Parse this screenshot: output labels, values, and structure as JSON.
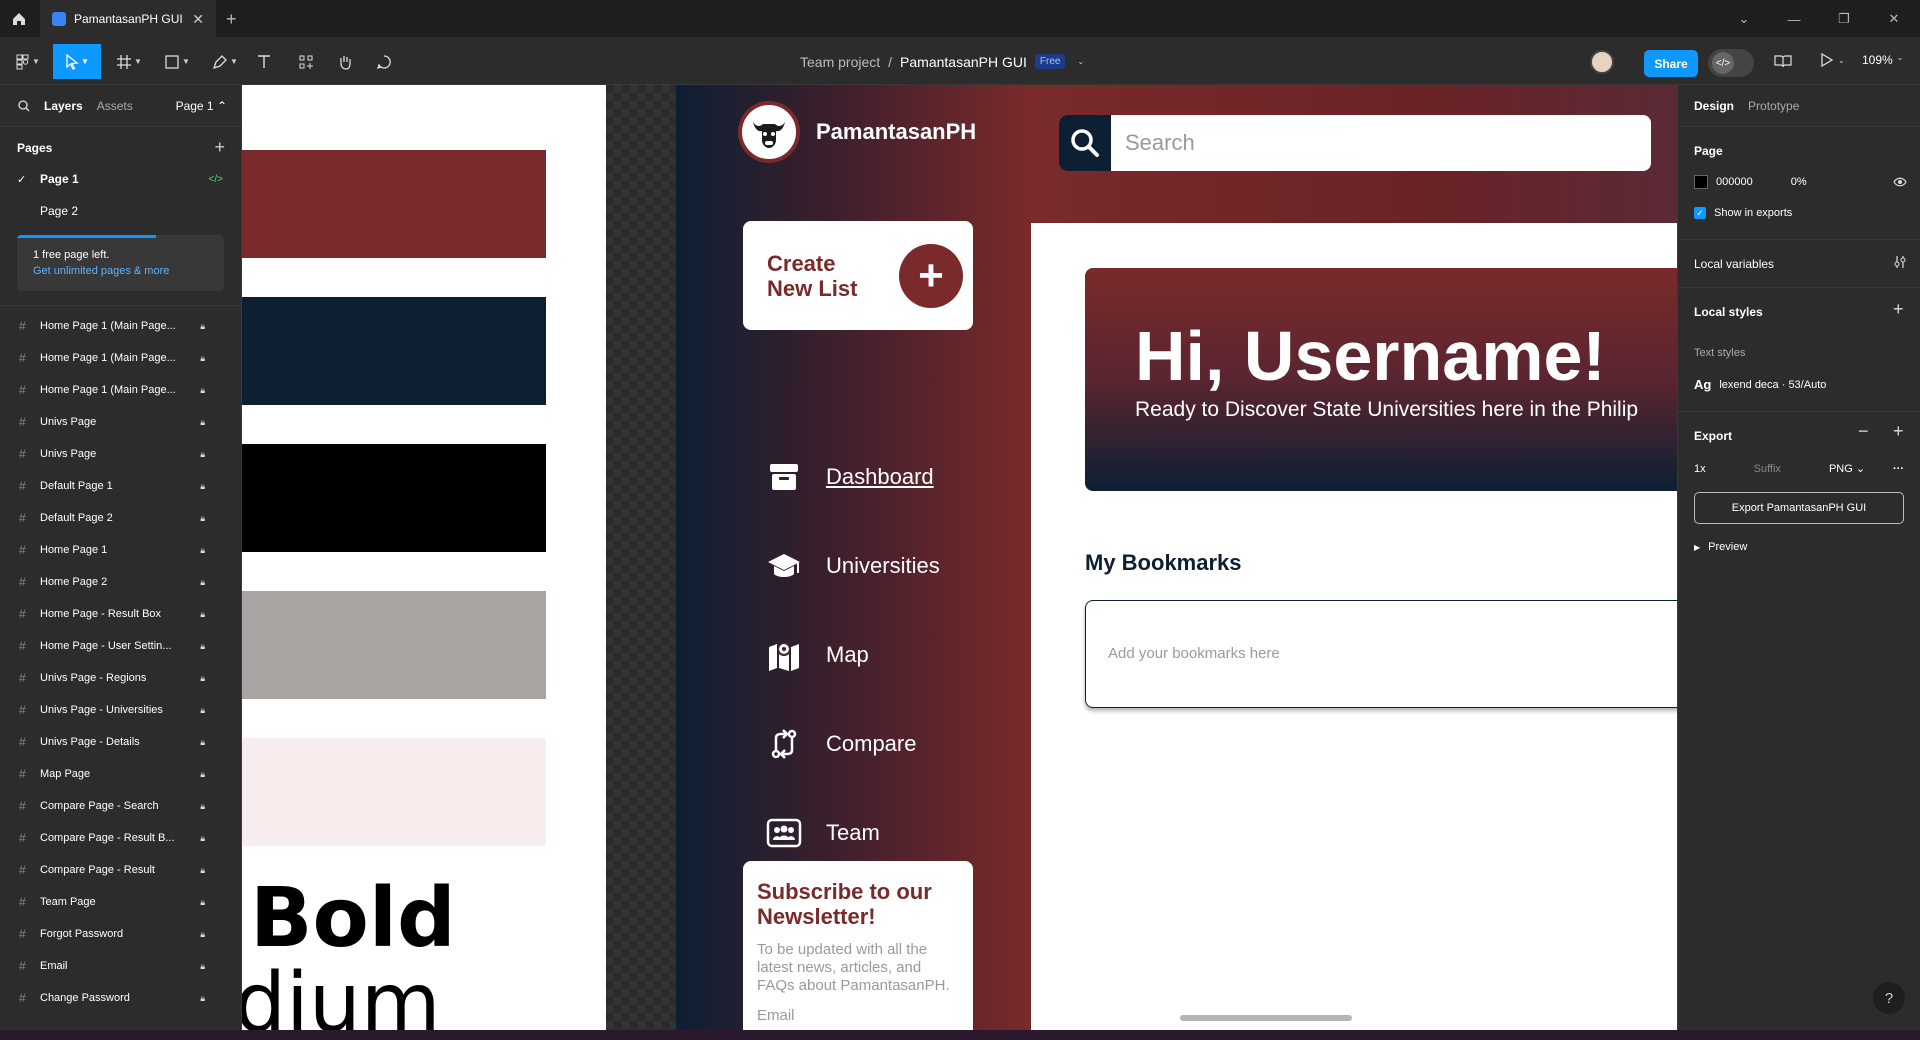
{
  "tabbar": {
    "tab_title": "PamantasanPH GUI"
  },
  "toolbar": {
    "team": "Team project",
    "sep": "/",
    "file": "PamantasanPH GUI",
    "plan_badge": "Free",
    "share": "Share",
    "zoom": "109%"
  },
  "left": {
    "tab_layers": "Layers",
    "tab_assets": "Assets",
    "page_select": "Page 1",
    "pages_title": "Pages",
    "pages": [
      "Page 1",
      "Page 2"
    ],
    "upsell_text": "1 free page left.",
    "upsell_link": "Get unlimited pages & more",
    "upsell_progress": 0.67,
    "layers": [
      "Home Page 1 (Main Page...",
      "Home Page 1 (Main Page...",
      "Home Page 1 (Main Page...",
      "Univs Page",
      "Univs Page",
      "Default Page 1",
      "Default Page 2",
      "Home Page 1",
      "Home Page 2",
      "Home Page - Result Box",
      "Home Page - User Settin...",
      "Univs Page - Regions",
      "Univs Page - Universities",
      "Univs Page - Details",
      "Map Page",
      "Compare Page - Search",
      "Compare Page - Result B...",
      "Compare Page - Result",
      "Team Page",
      "Forgot Password",
      "Email",
      "Change Password"
    ]
  },
  "styleguide": {
    "swatches": [
      "#7a2a2a",
      "#0d1f33",
      "#000000",
      "#a9a3a1",
      "#f9ecec"
    ],
    "type_1": "Bold",
    "type_2": "dium"
  },
  "app": {
    "brand": "PamantasanPH",
    "search_placeholder": "Search",
    "create_label": "Create New List",
    "create_plus": "+",
    "nav": [
      "Dashboard",
      "Universities",
      "Map",
      "Compare",
      "Team"
    ],
    "newsletter_title": "Subscribe to our Newsletter!",
    "newsletter_text": "To be updated  with all the latest news, articles,  and FAQs about PamantasanPH.",
    "newsletter_email": "Email",
    "greeting": "Hi, Username!",
    "greeting_sub": "Ready to Discover State Universities here in the Philip",
    "bookmarks_title": "My Bookmarks",
    "bookmarks_placeholder": "Add your bookmarks here"
  },
  "right": {
    "tab_design": "Design",
    "tab_prototype": "Prototype",
    "page_title": "Page",
    "page_color": "000000",
    "page_opacity": "0%",
    "show_exports": "Show in exports",
    "local_variables": "Local variables",
    "local_styles": "Local styles",
    "text_styles": "Text styles",
    "ag": "Ag",
    "text_style_name": "lexend deca · 53/Auto",
    "export": "Export",
    "export_scale": "1x",
    "export_suffix": "Suffix",
    "export_format": "PNG",
    "export_button": "Export PamantasanPH GUI",
    "preview": "Preview",
    "help": "?"
  },
  "colors": {
    "accent": "#0d99ff",
    "maroon": "#7a2a2a",
    "navy": "#0d1f33"
  }
}
